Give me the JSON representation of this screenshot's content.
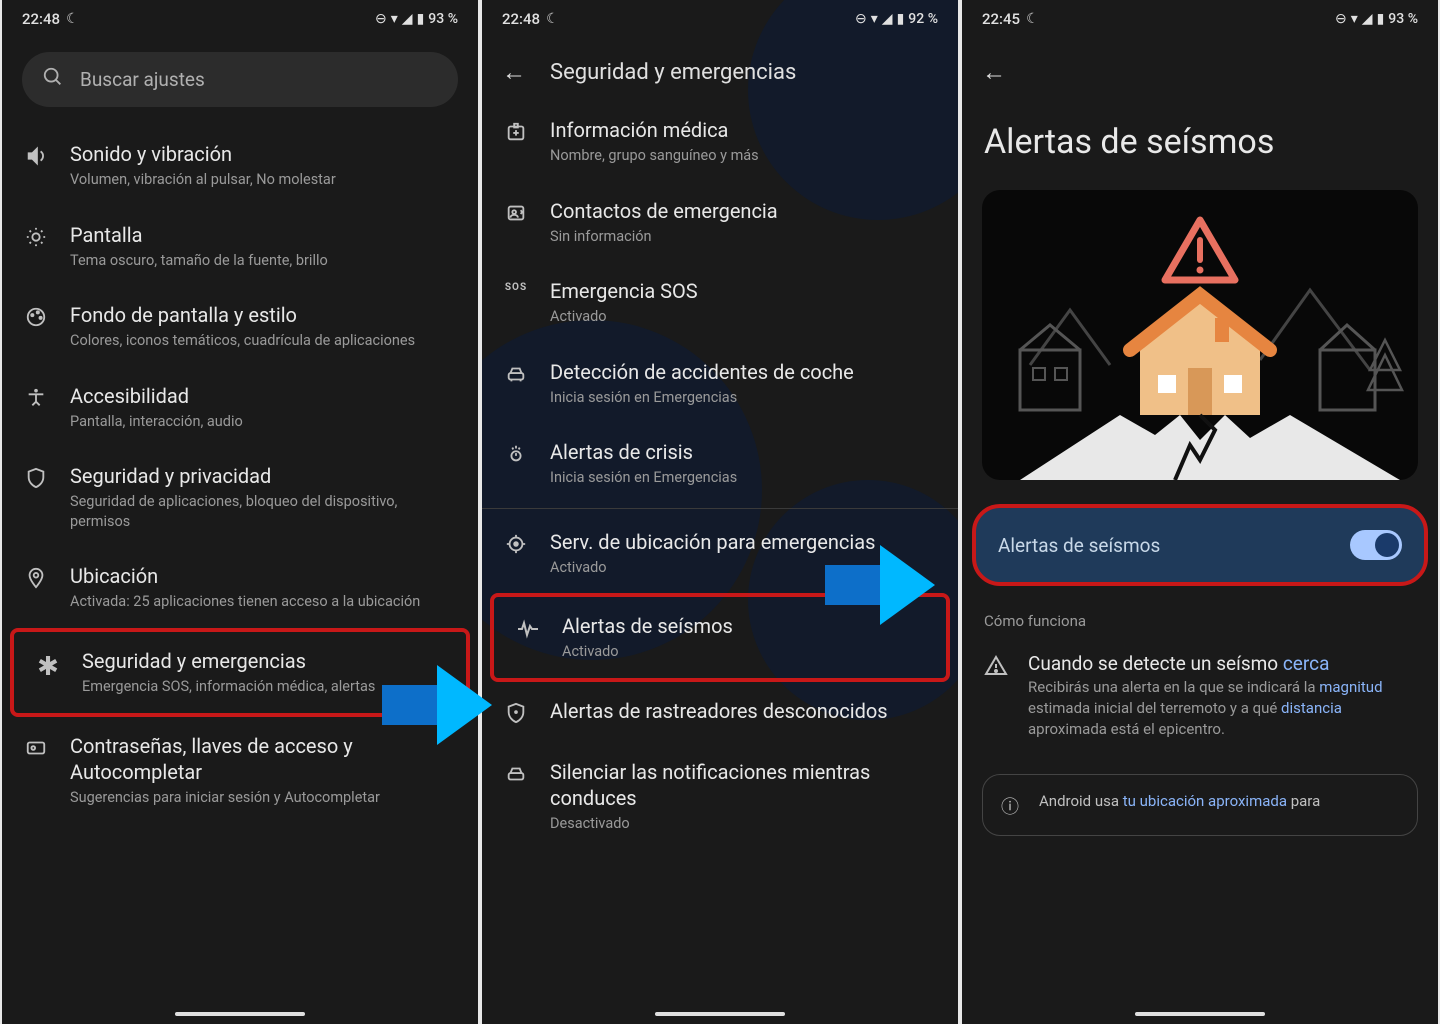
{
  "status": {
    "time1": "22:48",
    "time2": "22:48",
    "time3": "22:45",
    "batt1": "93 %",
    "batt2": "92 %",
    "batt3": "93 %"
  },
  "screen1": {
    "search_placeholder": "Buscar ajustes",
    "items": [
      {
        "title": "Sonido y vibración",
        "sub": "Volumen, vibración al pulsar, No molestar"
      },
      {
        "title": "Pantalla",
        "sub": "Tema oscuro, tamaño de la fuente, brillo"
      },
      {
        "title": "Fondo de pantalla y estilo",
        "sub": "Colores, iconos temáticos, cuadrícula de aplicaciones"
      },
      {
        "title": "Accesibilidad",
        "sub": "Pantalla, interacción, audio"
      },
      {
        "title": "Seguridad y privacidad",
        "sub": "Seguridad de aplicaciones, bloqueo del dispositivo, permisos"
      },
      {
        "title": "Ubicación",
        "sub": "Activada: 25 aplicaciones tienen acceso a la ubicación"
      },
      {
        "title": "Seguridad y emergencias",
        "sub": "Emergencia SOS, información médica, alertas"
      },
      {
        "title": "Contraseñas, llaves de acceso y Autocompletar",
        "sub": "Sugerencias para iniciar sesión y Autocompletar"
      }
    ]
  },
  "screen2": {
    "header": "Seguridad y emergencias",
    "items": [
      {
        "title": "Información médica",
        "sub": "Nombre, grupo sanguíneo y más"
      },
      {
        "title": "Contactos de emergencia",
        "sub": "Sin información"
      },
      {
        "title": "Emergencia SOS",
        "sub": "Activado"
      },
      {
        "title": "Detección de accidentes de coche",
        "sub": "Inicia sesión en Emergencias"
      },
      {
        "title": "Alertas de crisis",
        "sub": "Inicia sesión en Emergencias"
      },
      {
        "title": "Serv. de ubicación para emergencias",
        "sub": "Activado"
      },
      {
        "title": "Alertas de seísmos",
        "sub": "Activado"
      },
      {
        "title": "Alertas de rastreadores desconocidos",
        "sub": ""
      },
      {
        "title": "Silenciar las notificaciones mientras conduces",
        "sub": "Desactivado"
      }
    ]
  },
  "screen3": {
    "title": "Alertas de seísmos",
    "toggle_label": "Alertas de seísmos",
    "section": "Cómo funciona",
    "info_title_pre": "Cuando se detecte un seísmo ",
    "info_title_link": "cerca",
    "info_body_1": "Recibirás una alerta en la que se indicará la ",
    "info_body_link1": "magnitud",
    "info_body_2": " estimada inicial del terremoto y a qué ",
    "info_body_link2": "distancia",
    "info_body_3": " aproximada está el epicentro.",
    "footer_pre": "Android usa ",
    "footer_link": "tu ubicación aproximada",
    "footer_post": " para"
  }
}
